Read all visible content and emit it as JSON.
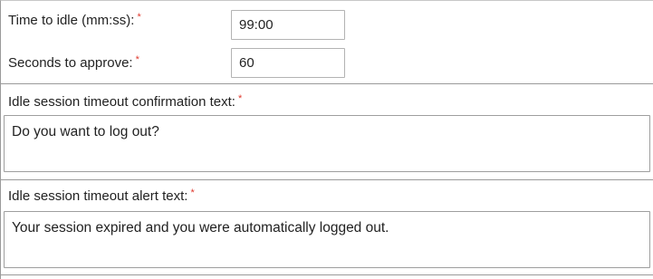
{
  "form": {
    "time_to_idle": {
      "label": "Time to idle (mm:ss):",
      "required_mark": "*",
      "value": "99:00"
    },
    "seconds_to_approve": {
      "label": "Seconds to approve:",
      "required_mark": "*",
      "value": "60"
    },
    "confirmation_text": {
      "label": "Idle session timeout confirmation text:",
      "required_mark": "*",
      "value": "Do you want to log out?"
    },
    "alert_text": {
      "label": "Idle session timeout alert text:",
      "required_mark": "*",
      "value": "Your session expired and you were automatically logged out."
    }
  },
  "colors": {
    "required_mark": "#e03a2f",
    "border": "#9e9e9e",
    "text": "#222222"
  }
}
